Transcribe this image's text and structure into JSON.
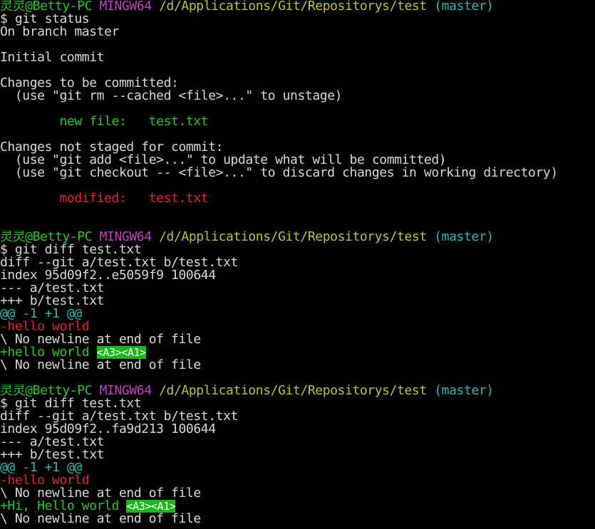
{
  "colors": {
    "background": "#000000",
    "foreground": "#d8d8d8",
    "user_host": "#2bc52b",
    "mingw": "#c342c3",
    "path": "#c0c03a",
    "branch": "#2fb7b7",
    "staged": "#2bc52b",
    "unstaged": "#d92b2b",
    "diff_removed": "#d92b2b",
    "diff_added": "#2bc52b",
    "hunk": "#2fb7b7",
    "whitespace_error_bg": "#1cb51c"
  },
  "lines": [
    {
      "segs": [
        {
          "text": "灵灵@Betty-PC ",
          "color": "green"
        },
        {
          "text": "MINGW64 ",
          "color": "magenta"
        },
        {
          "text": "/d/Applications/Git/Repositorys/test ",
          "color": "yellow"
        },
        {
          "text": "(master)",
          "color": "cyan"
        }
      ]
    },
    {
      "segs": [
        {
          "text": "$ git status",
          "color": "fg"
        }
      ]
    },
    {
      "segs": [
        {
          "text": "On branch master",
          "color": "fg"
        }
      ]
    },
    {
      "segs": []
    },
    {
      "segs": [
        {
          "text": "Initial commit",
          "color": "fg"
        }
      ]
    },
    {
      "segs": []
    },
    {
      "segs": [
        {
          "text": "Changes to be committed:",
          "color": "fg"
        }
      ]
    },
    {
      "segs": [
        {
          "text": "  (use \"git rm --cached <file>...\" to unstage)",
          "color": "fg"
        }
      ]
    },
    {
      "segs": []
    },
    {
      "segs": [
        {
          "text": "        new file:   test.txt",
          "color": "green"
        }
      ]
    },
    {
      "segs": []
    },
    {
      "segs": [
        {
          "text": "Changes not staged for commit:",
          "color": "fg"
        }
      ]
    },
    {
      "segs": [
        {
          "text": "  (use \"git add <file>...\" to update what will be committed)",
          "color": "fg"
        }
      ]
    },
    {
      "segs": [
        {
          "text": "  (use \"git checkout -- <file>...\" to discard changes in working directory)",
          "color": "fg"
        }
      ]
    },
    {
      "segs": []
    },
    {
      "segs": [
        {
          "text": "        modified:   test.txt",
          "color": "red"
        }
      ]
    },
    {
      "segs": []
    },
    {
      "segs": []
    },
    {
      "segs": [
        {
          "text": "灵灵@Betty-PC ",
          "color": "green"
        },
        {
          "text": "MINGW64 ",
          "color": "magenta"
        },
        {
          "text": "/d/Applications/Git/Repositorys/test ",
          "color": "yellow"
        },
        {
          "text": "(master)",
          "color": "cyan"
        }
      ]
    },
    {
      "segs": [
        {
          "text": "$ git diff test.txt",
          "color": "fg"
        }
      ]
    },
    {
      "segs": [
        {
          "text": "diff --git a/test.txt b/test.txt",
          "color": "fg"
        }
      ]
    },
    {
      "segs": [
        {
          "text": "index 95d09f2..e5059f9 100644",
          "color": "fg"
        }
      ]
    },
    {
      "segs": [
        {
          "text": "--- a/test.txt",
          "color": "fg"
        }
      ]
    },
    {
      "segs": [
        {
          "text": "+++ b/test.txt",
          "color": "fg"
        }
      ]
    },
    {
      "segs": [
        {
          "text": "@@ -1 +1 @@",
          "color": "cyan"
        }
      ]
    },
    {
      "segs": [
        {
          "text": "-hello world",
          "color": "red"
        }
      ]
    },
    {
      "segs": [
        {
          "text": "\\ No newline at end of file",
          "color": "fg"
        }
      ]
    },
    {
      "segs": [
        {
          "text": "+hello world ",
          "color": "green"
        },
        {
          "text": "<A3><A1>",
          "color": "hl"
        }
      ]
    },
    {
      "segs": [
        {
          "text": "\\ No newline at end of file",
          "color": "fg"
        }
      ]
    },
    {
      "segs": []
    },
    {
      "segs": [
        {
          "text": "灵灵@Betty-PC ",
          "color": "green"
        },
        {
          "text": "MINGW64 ",
          "color": "magenta"
        },
        {
          "text": "/d/Applications/Git/Repositorys/test ",
          "color": "yellow"
        },
        {
          "text": "(master)",
          "color": "cyan"
        }
      ]
    },
    {
      "segs": [
        {
          "text": "$ git diff test.txt",
          "color": "fg"
        }
      ]
    },
    {
      "segs": [
        {
          "text": "diff --git a/test.txt b/test.txt",
          "color": "fg"
        }
      ]
    },
    {
      "segs": [
        {
          "text": "index 95d09f2..fa9d213 100644",
          "color": "fg"
        }
      ]
    },
    {
      "segs": [
        {
          "text": "--- a/test.txt",
          "color": "fg"
        }
      ]
    },
    {
      "segs": [
        {
          "text": "+++ b/test.txt",
          "color": "fg"
        }
      ]
    },
    {
      "segs": [
        {
          "text": "@@ -1 +1 @@",
          "color": "cyan"
        }
      ]
    },
    {
      "segs": [
        {
          "text": "-hello world",
          "color": "red"
        }
      ]
    },
    {
      "segs": [
        {
          "text": "\\ No newline at end of file",
          "color": "fg"
        }
      ]
    },
    {
      "segs": [
        {
          "text": "+Hi, Hello world ",
          "color": "green"
        },
        {
          "text": "<A3><A1>",
          "color": "hl"
        }
      ]
    },
    {
      "segs": [
        {
          "text": "\\ No newline at end of file",
          "color": "fg"
        }
      ]
    }
  ]
}
